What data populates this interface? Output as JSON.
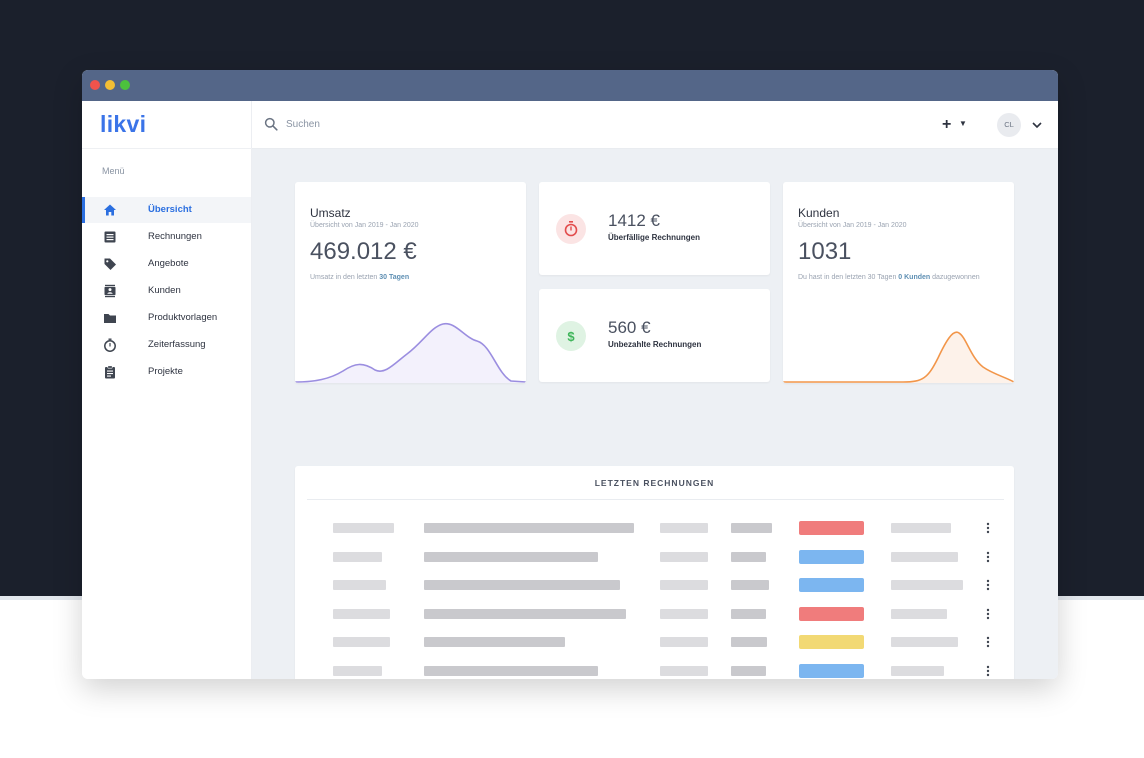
{
  "sidebar": {
    "logo": "likvi",
    "menu_title": "Menü",
    "items": [
      {
        "label": "Übersicht",
        "icon": "home-icon"
      },
      {
        "label": "Rechnungen",
        "icon": "invoice-list-icon"
      },
      {
        "label": "Angebote",
        "icon": "tag-icon"
      },
      {
        "label": "Kunden",
        "icon": "contacts-icon"
      },
      {
        "label": "Produktvorlagen",
        "icon": "folder-icon"
      },
      {
        "label": "Zeiterfassung",
        "icon": "stopwatch-icon"
      },
      {
        "label": "Projekte",
        "icon": "clipboard-icon"
      }
    ]
  },
  "topbar": {
    "search_placeholder": "Suchen",
    "plus_label": "+",
    "avatar_initials": "CL"
  },
  "umsatz": {
    "title": "Umsatz",
    "subtitle": "Übersicht von Jan 2019 - Jan 2020",
    "value": "469.012 €",
    "note_prefix": "Umsatz in den letzten ",
    "note_highlight": "30 Tagen"
  },
  "overdue": {
    "value": "1412 €",
    "label": "Überfällige Rechnungen",
    "icon": "stopwatch-icon"
  },
  "unpaid": {
    "value": "560 €",
    "label": "Unbezahlte Rechnungen",
    "icon": "dollar-icon"
  },
  "kunden": {
    "title": "Kunden",
    "subtitle": "Übersicht von Jan 2019 - Jan 2020",
    "value": "1031",
    "note_prefix": "Du hast in den letzten 30 Tagen ",
    "note_highlight": "0 Kunden",
    "note_suffix": " dazugewonnen"
  },
  "table": {
    "title": "LETZTEN RECHNUNGEN",
    "rows": [
      {
        "status": "red"
      },
      {
        "status": "blue"
      },
      {
        "status": "blue"
      },
      {
        "status": "red"
      },
      {
        "status": "yellow"
      },
      {
        "status": "blue"
      },
      {
        "status": "red"
      }
    ]
  },
  "colors": {
    "accent": "#2b6fe0",
    "umsatz_line": "#9b8ee0",
    "kunden_line": "#f2964a",
    "status_red": "#f07c7c",
    "status_blue": "#7cb6f0",
    "status_yellow": "#f2d974"
  }
}
